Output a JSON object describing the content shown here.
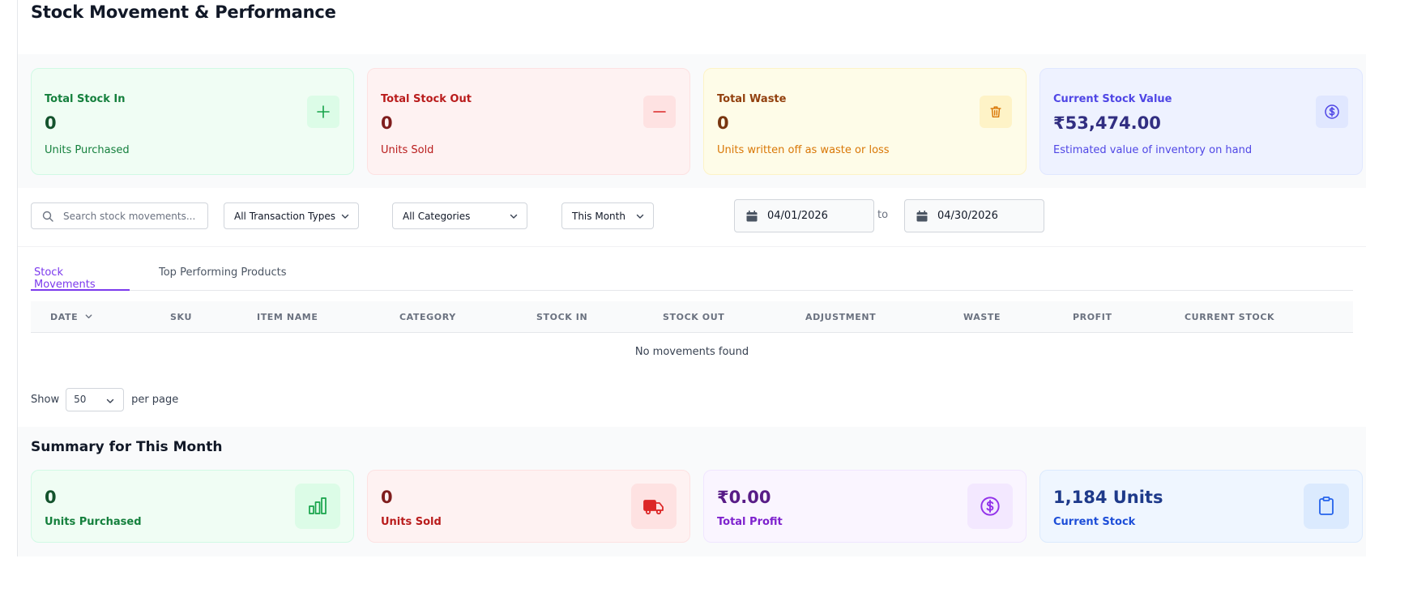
{
  "page": {
    "title": "Stock Movement & Performance"
  },
  "stats": [
    {
      "label": "Total Stock In",
      "value": "0",
      "sub": "Units Purchased",
      "icon": "plus-icon"
    },
    {
      "label": "Total Stock Out",
      "value": "0",
      "sub": "Units Sold",
      "icon": "minus-icon"
    },
    {
      "label": "Total Waste",
      "value": "0",
      "sub": "Units written off as waste or loss",
      "icon": "trash-icon"
    },
    {
      "label": "Current Stock Value",
      "value": "₹53,474.00",
      "sub": "Estimated value of inventory on hand",
      "icon": "dollar-circle-icon"
    }
  ],
  "filters": {
    "search_placeholder": "Search stock movements...",
    "transaction_type": "All Transaction Types",
    "category": "All Categories",
    "period": "This Month",
    "date_from": "04/01/2026",
    "date_to": "04/30/2026",
    "to_label": "to"
  },
  "tabs": [
    {
      "label": "Stock Movements",
      "active": true
    },
    {
      "label": "Top Performing Products",
      "active": false
    }
  ],
  "table": {
    "columns": [
      "DATE",
      "SKU",
      "ITEM NAME",
      "CATEGORY",
      "STOCK IN",
      "STOCK OUT",
      "ADJUSTMENT",
      "WASTE",
      "PROFIT",
      "CURRENT STOCK"
    ],
    "sort_column": "DATE",
    "empty_message": "No movements found"
  },
  "pagination": {
    "show_label": "Show",
    "per_page": "50",
    "per_page_label": "per page"
  },
  "summary": {
    "title": "Summary for This Month",
    "cards": [
      {
        "value": "0",
        "label": "Units Purchased",
        "icon": "bar-chart-icon"
      },
      {
        "value": "0",
        "label": "Units Sold",
        "icon": "truck-icon"
      },
      {
        "value": "₹0.00",
        "label": "Total Profit",
        "icon": "dollar-circle-icon"
      },
      {
        "value": "1,184 Units",
        "label": "Current Stock",
        "icon": "clipboard-icon"
      }
    ]
  },
  "colors": {
    "accent": "#7c3aed",
    "green": "#16a34a",
    "red": "#dc2626",
    "amber": "#d97706",
    "indigo": "#4f46e5"
  }
}
